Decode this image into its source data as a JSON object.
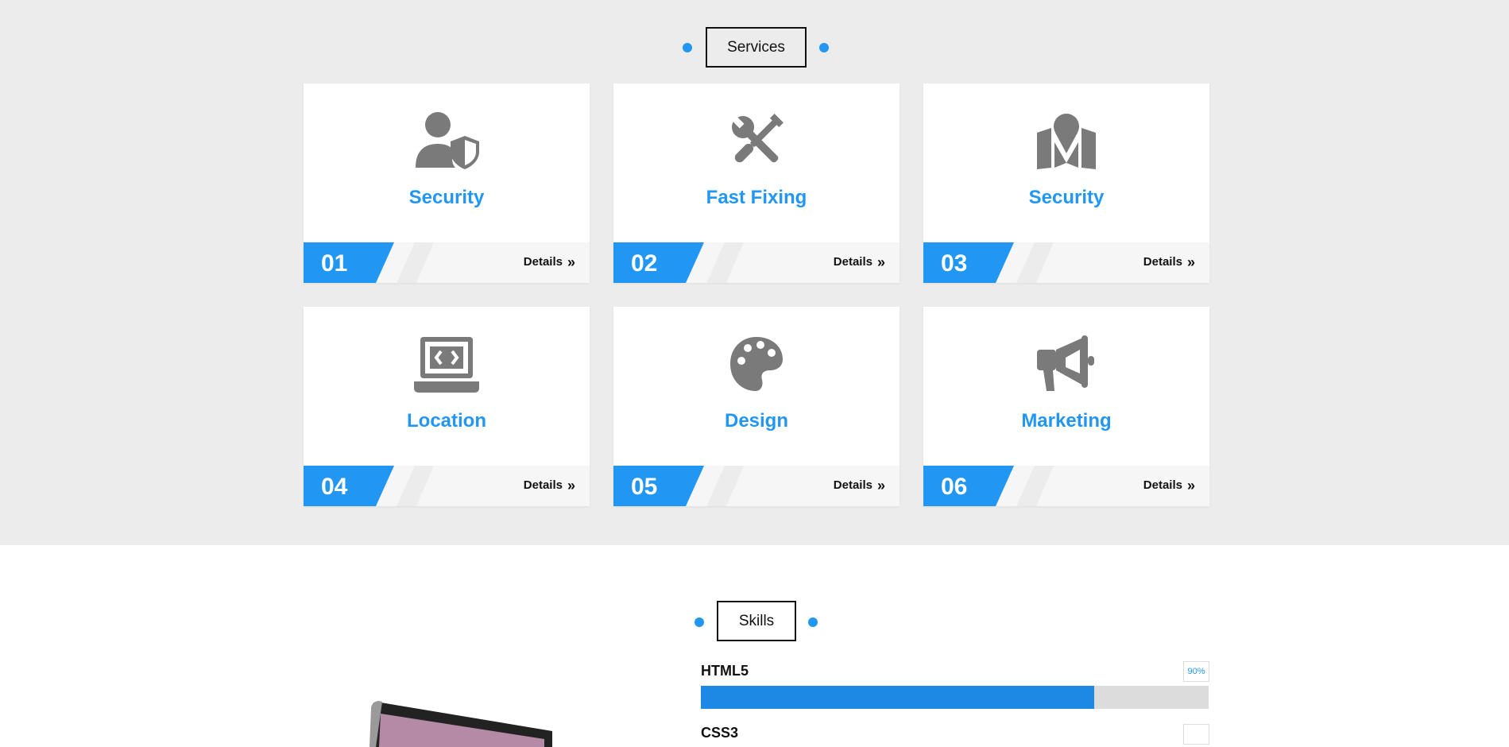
{
  "services": {
    "title": "Services",
    "cards": [
      {
        "number": "01",
        "title": "Security",
        "icon": "user-shield-icon",
        "details_label": "Details"
      },
      {
        "number": "02",
        "title": "Fast Fixing",
        "icon": "tools-icon",
        "details_label": "Details"
      },
      {
        "number": "03",
        "title": "Security",
        "icon": "map-location-icon",
        "details_label": "Details"
      },
      {
        "number": "04",
        "title": "Location",
        "icon": "laptop-code-icon",
        "details_label": "Details"
      },
      {
        "number": "05",
        "title": "Design",
        "icon": "palette-icon",
        "details_label": "Details"
      },
      {
        "number": "06",
        "title": "Marketing",
        "icon": "megaphone-icon",
        "details_label": "Details"
      }
    ]
  },
  "skills": {
    "title": "Skills",
    "items": [
      {
        "label": "HTML5",
        "percent_label": "90%",
        "percent": 90
      },
      {
        "label": "CSS3",
        "percent_label": "",
        "percent": null
      }
    ]
  },
  "colors": {
    "accent": "#2196f3",
    "bar_fill": "#1e88e5",
    "icon_gray": "#7a7a7a",
    "section_bg": "#ececec"
  }
}
